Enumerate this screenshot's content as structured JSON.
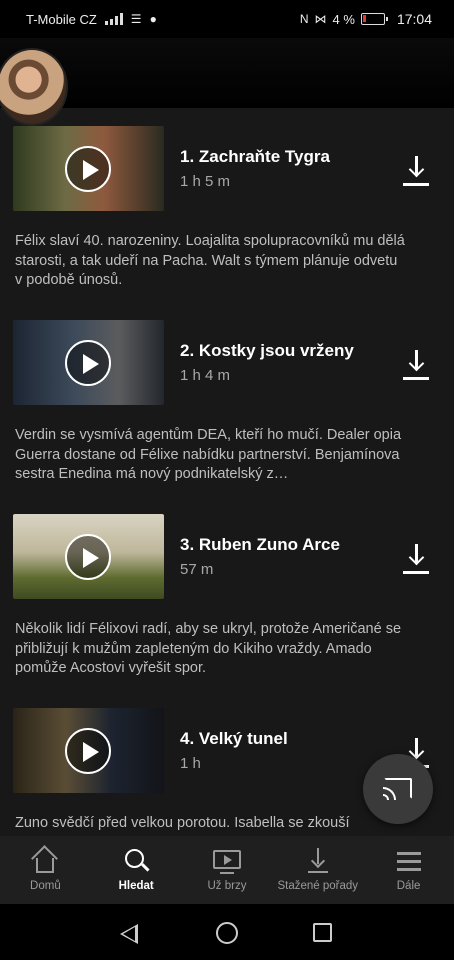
{
  "status_bar": {
    "carrier": "T-Mobile CZ",
    "battery": "4 %",
    "time": "17:04"
  },
  "episodes": [
    {
      "title": "1. Zachraňte Tygra",
      "duration": "1 h 5 m",
      "description": "Félix slaví 40. narozeniny. Loajalita spolupracovníků mu dělá starosti, a tak udeří na Pacha. Walt s týmem plánuje odvetu v podobě únosů."
    },
    {
      "title": "2. Kostky jsou vrženy",
      "duration": "1 h 4 m",
      "description": "Verdin se vysmívá agentům DEA, kteří ho mučí. Dealer opia Guerra dostane od Félixe nabídku partnerství. Benjamínova sestra Enedina má nový podnikatelský z…"
    },
    {
      "title": "3. Ruben Zuno Arce",
      "duration": "57 m",
      "description": "Několik lidí Félixovi radí, aby se ukryl, protože Američané se přibližují k mužům zapleteným do Kikiho vraždy. Amado pomůže Acostovi vyřešit spor."
    },
    {
      "title": "4. Velký tunel",
      "duration": "1 h",
      "description": "Zuno svědčí před velkou porotou. Isabella se zkouší dohodnout s Enedinou. Félix přichází za americkým"
    }
  ],
  "tabs": [
    {
      "label": "Domů",
      "icon": "home-icon",
      "active": false
    },
    {
      "label": "Hledat",
      "icon": "search-icon",
      "active": true
    },
    {
      "label": "Už brzy",
      "icon": "coming-soon-icon",
      "active": false
    },
    {
      "label": "Stažené pořady",
      "icon": "downloads-icon",
      "active": false
    },
    {
      "label": "Dále",
      "icon": "menu-icon",
      "active": false
    }
  ],
  "icons": {
    "episode_play": "play-icon",
    "episode_download": "download-icon",
    "cast": "cast-icon"
  },
  "colors": {
    "background": "#181818",
    "tabbar": "#1f1f1f",
    "text_secondary": "#a8a8a8"
  }
}
